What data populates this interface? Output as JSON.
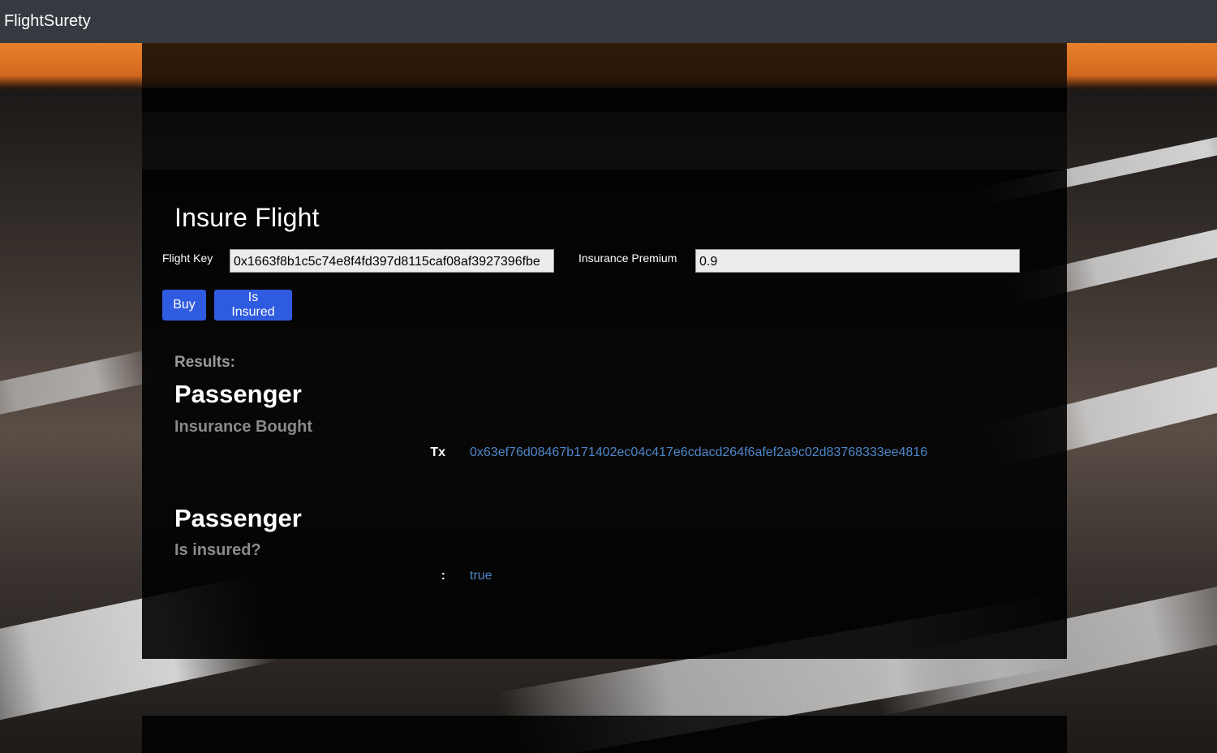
{
  "navbar": {
    "brand": "FlightSurety"
  },
  "form": {
    "title": "Insure Flight",
    "flight_key_label": "Flight Key",
    "flight_key_value": "0x1663f8b1c5c74e8f4fd397d8115caf08af3927396fbe",
    "premium_label": "Insurance Premium",
    "premium_value": "0.9",
    "buy_label": "Buy",
    "is_insured_label": "Is Insured"
  },
  "results": {
    "label": "Results:",
    "entries": [
      {
        "heading": "Passenger",
        "subheading": "Insurance Bought",
        "row_label": "Tx",
        "row_value": "0x63ef76d08467b171402ec04c417e6cdacd264f6afef2a9c02d83768333ee4816"
      },
      {
        "heading": "Passenger",
        "subheading": "Is insured?",
        "row_label": ":",
        "row_value": "true"
      }
    ]
  },
  "colors": {
    "navbar_bg": "#343a40",
    "button_primary": "#2f5be0",
    "link_value": "#4d86c9"
  }
}
